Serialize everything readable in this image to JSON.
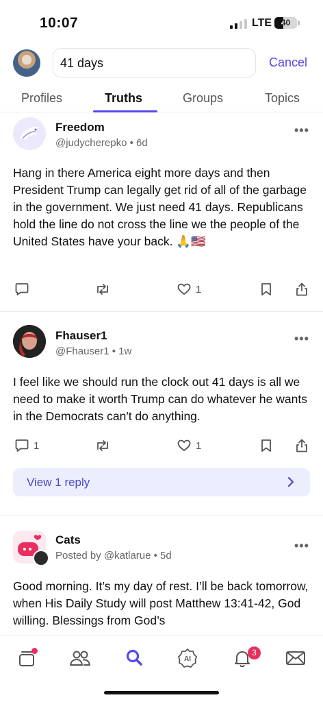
{
  "status_bar": {
    "time": "10:07",
    "network": "LTE",
    "battery": "40"
  },
  "search": {
    "query": "41 days",
    "cancel_label": "Cancel"
  },
  "tabs": [
    {
      "label": "Profiles"
    },
    {
      "label": "Truths"
    },
    {
      "label": "Groups"
    },
    {
      "label": "Topics"
    }
  ],
  "posts": [
    {
      "name": "Freedom",
      "handle": "@judycherepko • 6d",
      "text": "Hang in there America eight more days and then President Trump can legally get rid of all of the garbage in the government. We just need 41 days. Republicans hold the line do not cross the line we the people of the United States have your back. 🙏🇺🇸",
      "replies": "",
      "likes": "1"
    },
    {
      "name": "Fhauser1",
      "handle": "@Fhauser1 • 1w",
      "text": "I feel like we should run the clock out 41 days is all we need to make it worth Trump can do whatever he wants in the Democrats can't do anything.",
      "replies": "1",
      "likes": "1",
      "view_replies_label": "View 1 reply"
    },
    {
      "name": "Cats",
      "handle": "Posted by @katlarue • 5d",
      "text": "Good morning. It’s my day of rest. I’ll be back tomorrow, when His Daily Study will post Matthew 13:41-42, God willing. Blessings from God’s"
    }
  ],
  "bottom_nav": {
    "items": [
      "feed-icon",
      "people-icon",
      "search-icon",
      "ai-icon",
      "bell-icon",
      "mail-icon"
    ],
    "notification_badge": "3"
  },
  "colors": {
    "accent": "#5448ee",
    "badge": "#ea2f5f",
    "reply_bg": "#eceefe"
  }
}
